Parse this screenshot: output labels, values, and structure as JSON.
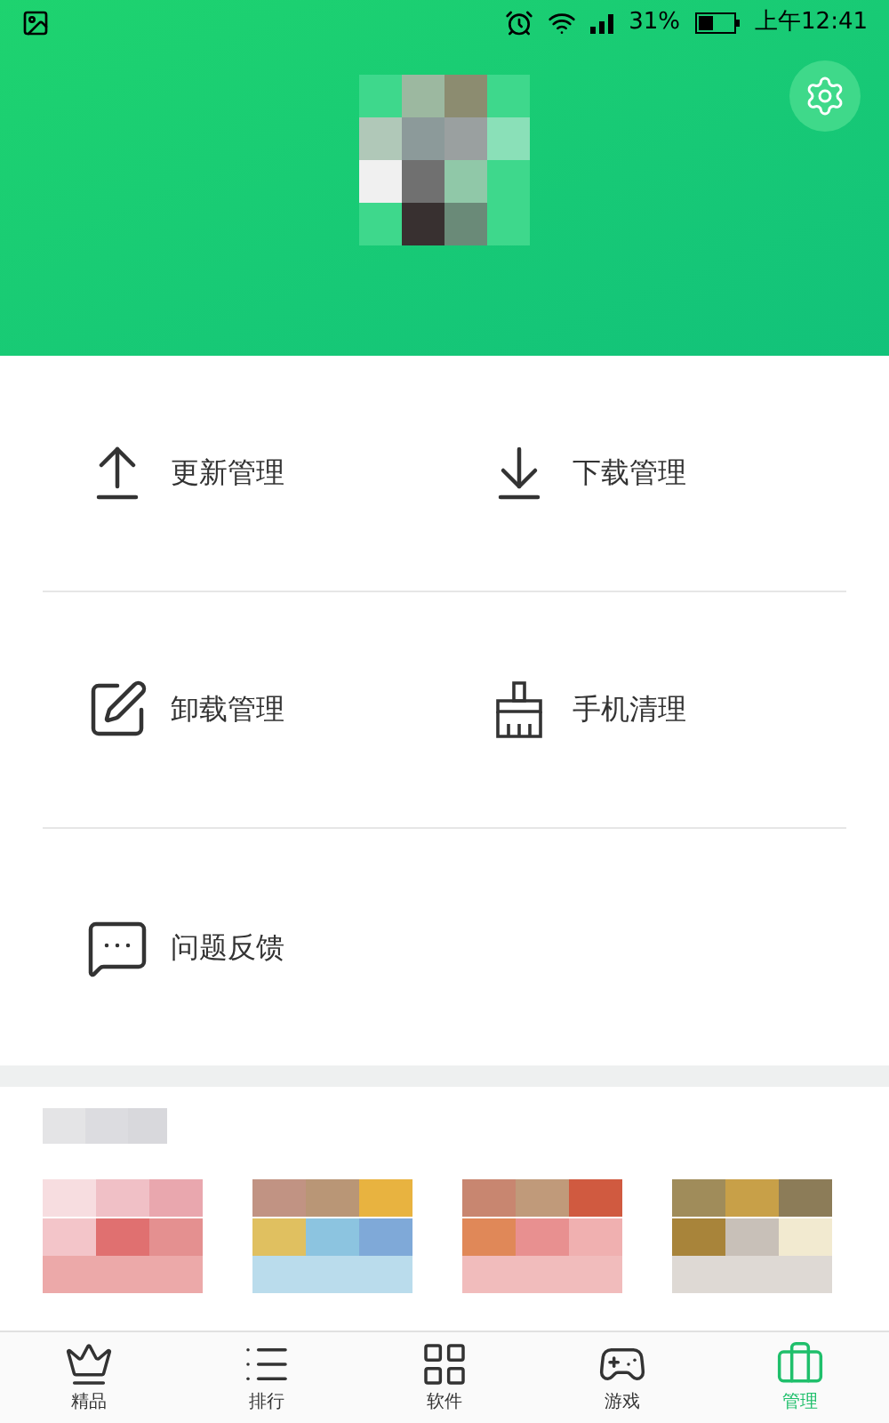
{
  "status_bar": {
    "battery": "31%",
    "time": "上午12:41"
  },
  "header": {
    "avatar": {
      "kind": "picture"
    }
  },
  "menu_rows": [
    [
      {
        "kind": "upload",
        "label": "更新管理"
      },
      {
        "kind": "download",
        "label": "下载管理"
      }
    ],
    [
      {
        "kind": "uninstall",
        "label": "卸载管理"
      },
      {
        "kind": "clean",
        "label": "手机清理"
      }
    ],
    [
      {
        "kind": "feedback",
        "label": "问题反馈"
      }
    ]
  ],
  "apps": [
    {
      "kind": "picture"
    },
    {
      "kind": "picture"
    },
    {
      "kind": "picture"
    },
    {
      "kind": "picture"
    }
  ],
  "nav": [
    {
      "kind": "crown",
      "label": "精品",
      "selected": false
    },
    {
      "kind": "list",
      "label": "排行",
      "selected": false
    },
    {
      "kind": "grid",
      "label": "软件",
      "selected": false
    },
    {
      "kind": "game",
      "label": "游戏",
      "selected": false
    },
    {
      "kind": "manage",
      "label": "管理",
      "selected": true
    }
  ]
}
